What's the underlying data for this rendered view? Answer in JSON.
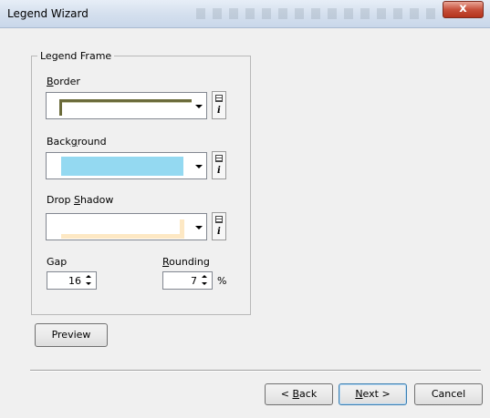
{
  "window": {
    "title": "Legend Wizard",
    "close_glyph": "x"
  },
  "group": {
    "title": "Legend Frame"
  },
  "border": {
    "label_pre": "",
    "label_key": "B",
    "label_post": "order",
    "swatch_color": "#6b6b3a"
  },
  "background": {
    "label_pre": "Back",
    "label_key": "g",
    "label_post": "round",
    "swatch_color": "#94d9f1"
  },
  "drop_shadow": {
    "label_pre": "Drop ",
    "label_key": "S",
    "label_post": "hadow",
    "swatch_color": "#fde8c4"
  },
  "gap": {
    "label": "Gap",
    "value": "16"
  },
  "rounding": {
    "label_pre": "",
    "label_key": "R",
    "label_post": "ounding",
    "value": "7",
    "unit": "%"
  },
  "buttons": {
    "preview": "Preview",
    "back_pre": "< ",
    "back_key": "B",
    "back_post": "ack",
    "next_pre": "",
    "next_key": "N",
    "next_post": "ext >",
    "cancel": "Cancel"
  },
  "icons": {
    "palette": "grid-icon",
    "info": "info-icon",
    "dropdown": "chevron-down-icon"
  }
}
